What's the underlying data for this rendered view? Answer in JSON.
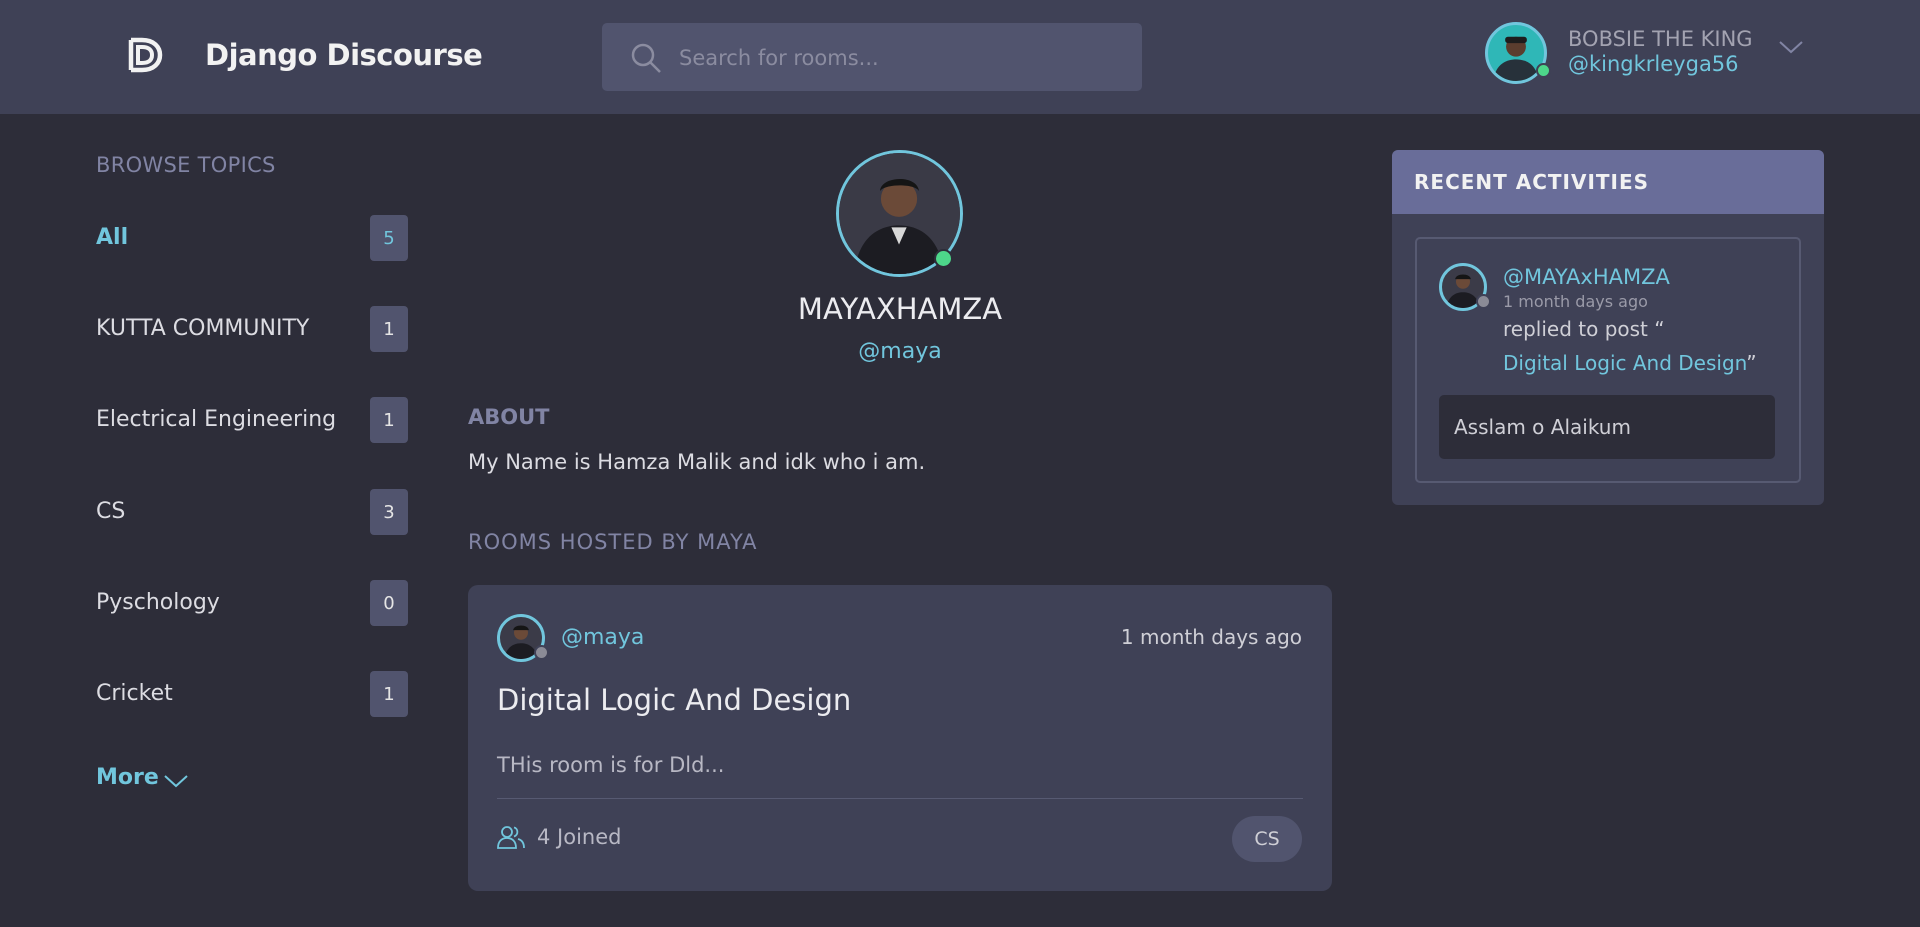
{
  "header": {
    "brand": "Django Discourse",
    "search_placeholder": "Search for rooms...",
    "user_name": "BOBSIE THE KING",
    "user_handle": "@kingkrleyga56",
    "online_color": "#4dd68a"
  },
  "sidebar": {
    "title": "BROWSE TOPICS",
    "topics": [
      {
        "name": "All",
        "count": "5"
      },
      {
        "name": "KUTTA COMMUNITY",
        "count": "1"
      },
      {
        "name": "Electrical Engineering",
        "count": "1"
      },
      {
        "name": "CS",
        "count": "3"
      },
      {
        "name": "Pyschology",
        "count": "0"
      },
      {
        "name": "Cricket",
        "count": "1"
      }
    ],
    "more_label": "More"
  },
  "profile": {
    "name": "MAYAXHAMZA",
    "handle": "@maya",
    "about_title": "ABOUT",
    "about_text": "My Name is Hamza Malik and idk who i am.",
    "rooms_title": "ROOMS HOSTED BY MAYA"
  },
  "room": {
    "host": "@maya",
    "time": "1 month days ago",
    "title": "Digital Logic And Design",
    "description": "THis room is for Dld...",
    "joined": "4 Joined",
    "topic": "CS"
  },
  "activity": {
    "title": "RECENT ACTIVITIES",
    "user": "@MAYAxHAMZA",
    "time": "1 month days ago",
    "text": "replied to post “",
    "link": "Digital Logic And Design",
    "link_end": "”",
    "message": "Asslam o Alaikum"
  }
}
